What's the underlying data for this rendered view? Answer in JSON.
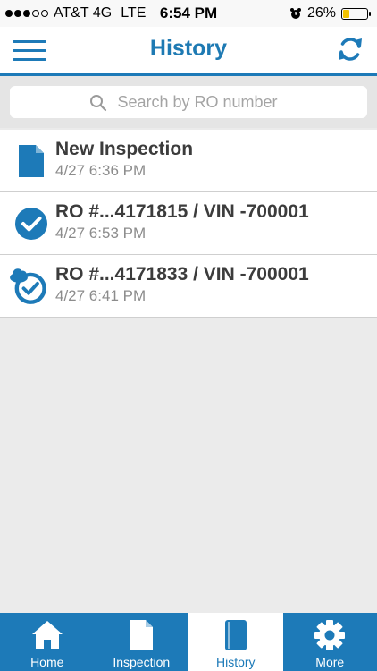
{
  "status_bar": {
    "carrier": "AT&T 4G",
    "network": "LTE",
    "time": "6:54 PM",
    "battery": "26%",
    "battery_level": 0.26,
    "signal_bars": 3
  },
  "header": {
    "title": "History",
    "menu_icon": "hamburger-menu-icon",
    "refresh_icon": "refresh-icon"
  },
  "search": {
    "placeholder": "Search by RO number",
    "value": ""
  },
  "history": {
    "items": [
      {
        "title": "New Inspection",
        "time": "4/27 6:36 PM",
        "icon": "document-icon"
      },
      {
        "title": "RO #...4171815 / VIN -700001",
        "time": "4/27 6:53 PM",
        "icon": "check-circle-icon"
      },
      {
        "title": "RO #...4171833 / VIN -700001",
        "time": "4/27 6:41 PM",
        "icon": "cloud-sync-check-icon"
      }
    ]
  },
  "tabs": [
    {
      "label": "Home",
      "icon": "home-icon",
      "active": false
    },
    {
      "label": "Inspection",
      "icon": "document-icon",
      "active": false
    },
    {
      "label": "History",
      "icon": "book-icon",
      "active": true
    },
    {
      "label": "More",
      "icon": "gear-icon",
      "active": false
    }
  ],
  "colors": {
    "accent": "#1d7ab8",
    "background": "#ebebeb",
    "battery": "#f2c200"
  }
}
